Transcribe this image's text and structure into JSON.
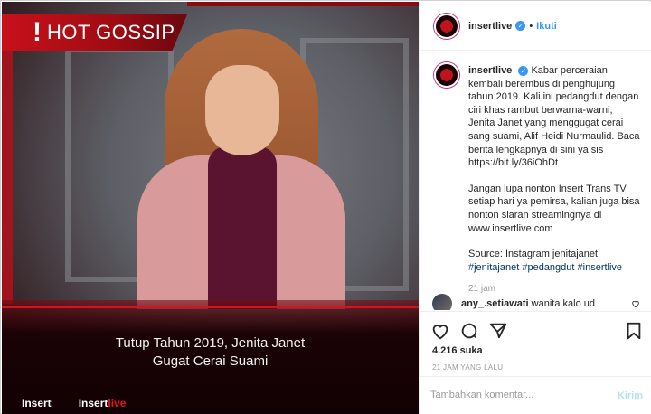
{
  "media": {
    "banner_bang": "!",
    "banner_text": "HOT GOSSIP",
    "caption_line1": "Tutup Tahun 2019, Jenita Janet",
    "caption_line2": "Gugat Cerai Suami",
    "logo_left": "Insert",
    "logo_right_a": "Insert",
    "logo_right_b": "live"
  },
  "header": {
    "username": "insertlive",
    "verified": "✓",
    "separator": "•",
    "follow_label": "Ikuti"
  },
  "post": {
    "username": "insertlive",
    "verified": "✓",
    "para1": "Kabar perceraian kembali berembus di penghujung tahun 2019. Kali ini pedangdut dengan ciri khas rambut berwarna-warni, Jenita Janet yang menggugat cerai sang suami, Alif Heidi Nurmaulid. Baca berita lengkapnya di sini ya sis https://bit.ly/36iOhDt",
    "para2": "Jangan lupa nonton Insert Trans TV setiap hari ya pemirsa, kalian juga bisa nonton siaran streamingnya di www.insertlive.com",
    "para3": "Source: Instagram jenitajanet",
    "tag1": "#jenitajanet",
    "tag2": "#pedangdut",
    "tag3": "#insertlive",
    "time": "21 jam"
  },
  "comment": {
    "username": "any_.setiawati",
    "text": "wanita kalo ud"
  },
  "likes_label": "4.216 suka",
  "ago_label": "21 JAM YANG LALU",
  "add_comment": {
    "placeholder": "Tambahkan komentar...",
    "send_label": "Kirim"
  },
  "colors": {
    "accent": "#3897f0",
    "brand_red": "#c8101a",
    "send_disabled": "#b2dffc"
  }
}
